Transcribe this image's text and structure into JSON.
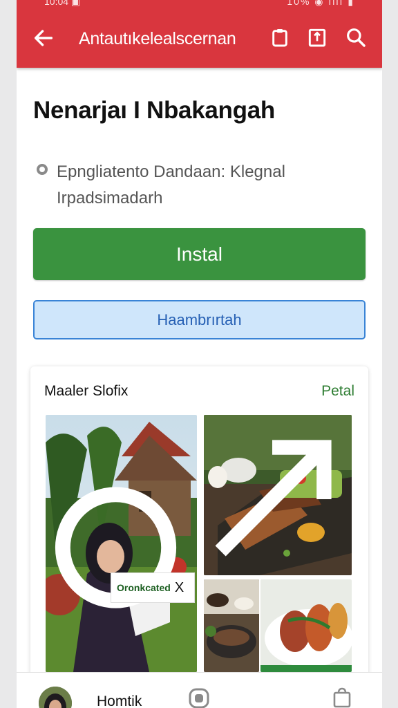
{
  "status": {
    "time": "10:04 ▣",
    "right": "10% ◉ ıllı ▮"
  },
  "appbar": {
    "title": "Antautıkelealscernan"
  },
  "app": {
    "name": "Nenarjaı I Nbakangah",
    "developer": "Epngliatento Dandaan: Klegnal Irpadsimadarh"
  },
  "buttons": {
    "install": "Instal",
    "secondary": "Haambrırtah"
  },
  "screenshots": {
    "title": "Maaler Slofix",
    "more": "Petal",
    "ad_label": "Oronkcated",
    "ad_close": "X"
  },
  "bottom_nav": {
    "label": "Homtik"
  },
  "colors": {
    "primary": "#d9363e",
    "install": "#3a933f",
    "secondary_bg": "#cfe6fb",
    "link": "#2e7d32"
  }
}
